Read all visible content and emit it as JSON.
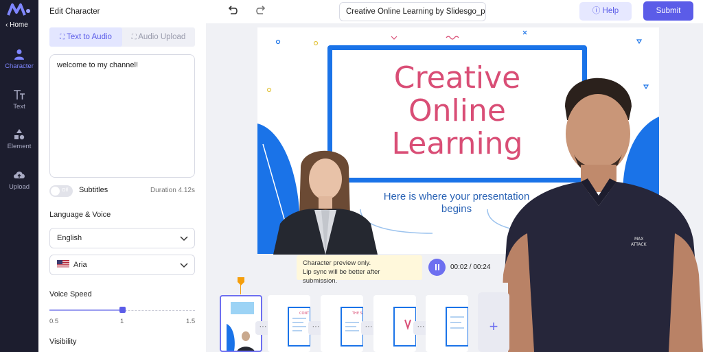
{
  "nav": {
    "home": "Home",
    "items": [
      {
        "label": "Character",
        "icon": "person-icon"
      },
      {
        "label": "Text",
        "icon": "text-icon"
      },
      {
        "label": "Element",
        "icon": "shapes-icon"
      },
      {
        "label": "Upload",
        "icon": "cloud-upload-icon"
      }
    ]
  },
  "panel": {
    "title": "Edit Character",
    "tabs": [
      "Text to Audio",
      "Audio Upload"
    ],
    "script_text": "welcome to my channel!",
    "subtitles_toggle": "Off",
    "subtitles_label": "Subtitles",
    "duration": "Duration 4.12s",
    "language_voice_label": "Language & Voice",
    "language": "English",
    "voice": "Aria",
    "voice_speed_label": "Voice Speed",
    "speed_ticks": [
      "0.5",
      "1",
      "1.5"
    ],
    "speed_value": 1,
    "visibility_label": "Visibility"
  },
  "topbar": {
    "project_title": "Creative Online Learning by Slidesgo_p",
    "help": "Help",
    "submit": "Submit"
  },
  "slide": {
    "title_line1": "Creative",
    "title_line2": "Online",
    "title_line3": "Learning",
    "subtitle_line1": "Here is where your presentation",
    "subtitle_line2": "begins",
    "shirt_text_1": "MAX",
    "shirt_text_2": "ATTACK"
  },
  "playback": {
    "tooltip_line1": "Character preview only.",
    "tooltip_line2": "Lip sync will be better after submission.",
    "time": "00:02 / 00:24"
  },
  "timeline": {
    "thumb_labels": [
      "CONT",
      "THE S"
    ],
    "more": "···",
    "add": "+"
  },
  "colors": {
    "accent": "#5b5ce8",
    "sidebar_bg": "#1c1d2e",
    "slide_blue": "#1a73e8",
    "slide_pink": "#d94e76"
  }
}
